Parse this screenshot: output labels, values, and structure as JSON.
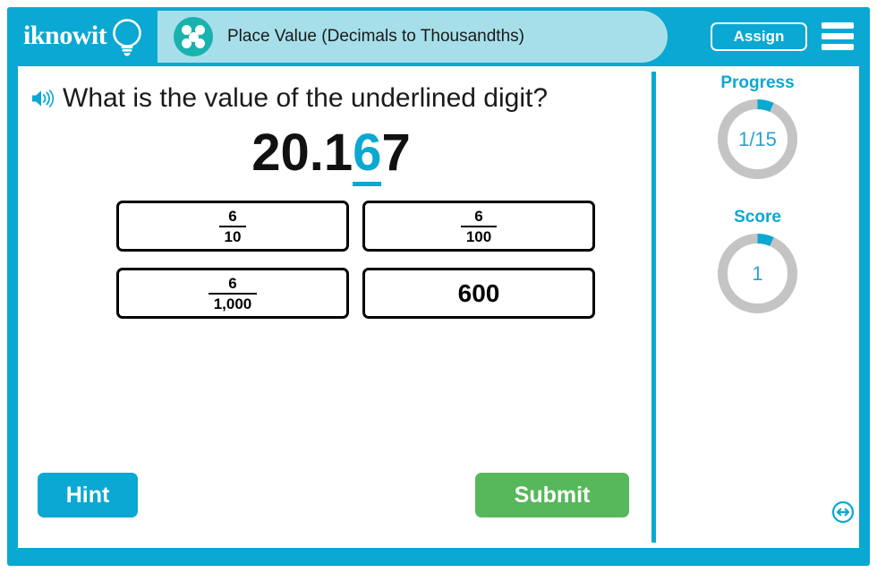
{
  "header": {
    "logo_text": "iknowit",
    "logo_icon": "lightbulb-icon",
    "badge_icon": "five-dots-icon",
    "title": "Place Value (Decimals to Thousandths)",
    "assign_label": "Assign",
    "menu_icon": "hamburger-menu-icon"
  },
  "question": {
    "speaker_icon": "speaker-audio-icon",
    "prompt": "What is the value of the underlined digit?",
    "number_prefix": "20.1",
    "number_highlight": "6",
    "number_suffix": "7",
    "full_number": "20.167"
  },
  "choices": [
    {
      "type": "fraction",
      "numerator": "6",
      "denominator": "10",
      "label": "6/10"
    },
    {
      "type": "fraction",
      "numerator": "6",
      "denominator": "100",
      "label": "6/100"
    },
    {
      "type": "fraction",
      "numerator": "6",
      "denominator": "1,000",
      "label": "6/1,000"
    },
    {
      "type": "plain",
      "value": "600",
      "label": "600"
    }
  ],
  "actions": {
    "hint_label": "Hint",
    "submit_label": "Submit",
    "resize_icon": "resize-horizontal-icon"
  },
  "stats": {
    "progress": {
      "label": "Progress",
      "value": "1/15",
      "current": 1,
      "total": 15,
      "percent": 6.67
    },
    "score": {
      "label": "Score",
      "value": "1",
      "current": 1,
      "total": 15,
      "percent": 6.67
    }
  },
  "colors": {
    "brand_blue": "#0aa8d2",
    "title_pill": "#a6dfea",
    "badge_teal": "#19b2ae",
    "submit_green": "#56b75b",
    "donut_track": "#c4c4c4",
    "donut_fill": "#0aa8d2",
    "highlight": "#0aa8d2"
  }
}
